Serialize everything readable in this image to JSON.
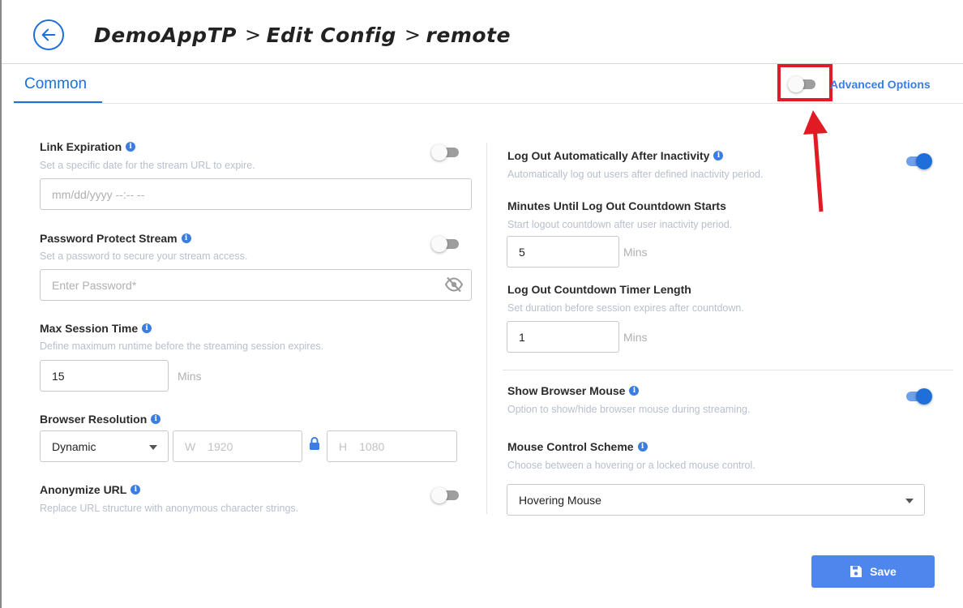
{
  "header": {
    "crumbs": [
      "DemoAppTP",
      "Edit Config",
      "remote"
    ],
    "separator": ">"
  },
  "tabs": {
    "common": "Common"
  },
  "advanced": {
    "label": "Advanced Options",
    "enabled": false
  },
  "left": {
    "link_expiration": {
      "label": "Link Expiration",
      "desc": "Set a specific date for the stream URL to expire.",
      "placeholder": "mm/dd/yyyy --:-- --",
      "enabled": false
    },
    "password": {
      "label": "Password Protect Stream",
      "desc": "Set a password to secure your stream access.",
      "placeholder": "Enter Password*",
      "enabled": false
    },
    "max_session": {
      "label": "Max Session Time",
      "desc": "Define maximum runtime before the streaming session expires.",
      "value": "15",
      "unit": "Mins"
    },
    "resolution": {
      "label": "Browser Resolution",
      "select_value": "Dynamic",
      "w_prefix": "W",
      "w_value": "1920",
      "h_prefix": "H",
      "h_value": "1080"
    },
    "anonymize": {
      "label": "Anonymize URL",
      "desc": "Replace URL structure with anonymous character strings.",
      "enabled": false
    }
  },
  "right": {
    "logout_auto": {
      "label": "Log Out Automatically After Inactivity",
      "desc": "Automatically log out users after defined inactivity period.",
      "enabled": true
    },
    "minutes_until": {
      "label": "Minutes Until Log Out Countdown Starts",
      "desc": "Start logout countdown after user inactivity period.",
      "value": "5",
      "unit": "Mins"
    },
    "countdown_length": {
      "label": "Log Out Countdown Timer Length",
      "desc": "Set duration before session expires after countdown.",
      "value": "1",
      "unit": "Mins"
    },
    "browser_mouse": {
      "label": "Show Browser Mouse",
      "desc": "Option to show/hide browser mouse during streaming.",
      "enabled": true
    },
    "mouse_scheme": {
      "label": "Mouse Control Scheme",
      "desc": "Choose between a hovering or a locked mouse control.",
      "value": "Hovering Mouse"
    }
  },
  "footer": {
    "save_label": "Save"
  },
  "colors": {
    "accent": "#1e6fd9",
    "save_bg": "#4f86ed",
    "highlight": "#e01b24"
  },
  "icons": [
    "arrow-left-icon",
    "info-icon",
    "eye-off-icon",
    "lock-icon",
    "caret-down-icon",
    "floppy-disk-icon"
  ]
}
